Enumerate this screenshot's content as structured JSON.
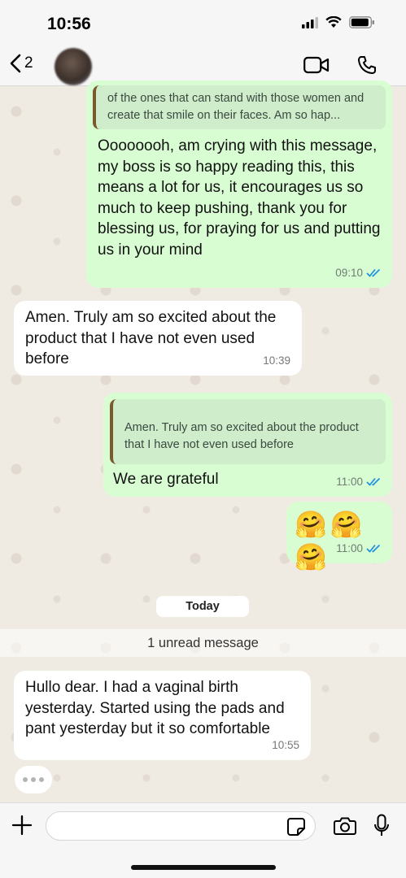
{
  "status_bar": {
    "time": "10:56"
  },
  "header": {
    "back_count": "2"
  },
  "messages": {
    "m1": {
      "quote": "of the ones that can stand with those women and create that smile on their faces. Am so hap...",
      "text": "Oooooooh, am crying with this message, my boss is so happy reading this, this means a lot for us, it encourages us so much to keep pushing,            thank you for blessing us, for praying for us and putting us in your mind",
      "time": "09:10"
    },
    "m2": {
      "text": "Amen. Truly am so excited about the product that I have not even used before",
      "time": "10:39"
    },
    "m3": {
      "quote": "Amen. Truly am so excited about the product that I have not even used before",
      "text": "We are grateful",
      "time": "11:00"
    },
    "m4": {
      "text": "🤗🤗🤗",
      "time": "11:00"
    },
    "m5": {
      "text": "Hullo dear. I had a vaginal birth yesterday. Started using the pads and pant yesterday but it so comfortable",
      "time": "10:55"
    }
  },
  "date_pill": "Today",
  "unread_label": "1 unread message",
  "input": {
    "placeholder": ""
  },
  "colors": {
    "outgoing": "#d9fdd3",
    "incoming": "#ffffff",
    "tick_blue": "#1d8fe0",
    "background": "#efeae2"
  },
  "icons": [
    "back-chevron-icon",
    "video-call-icon",
    "phone-icon",
    "plus-icon",
    "sticker-icon",
    "camera-icon",
    "microphone-icon",
    "double-check-icon"
  ]
}
